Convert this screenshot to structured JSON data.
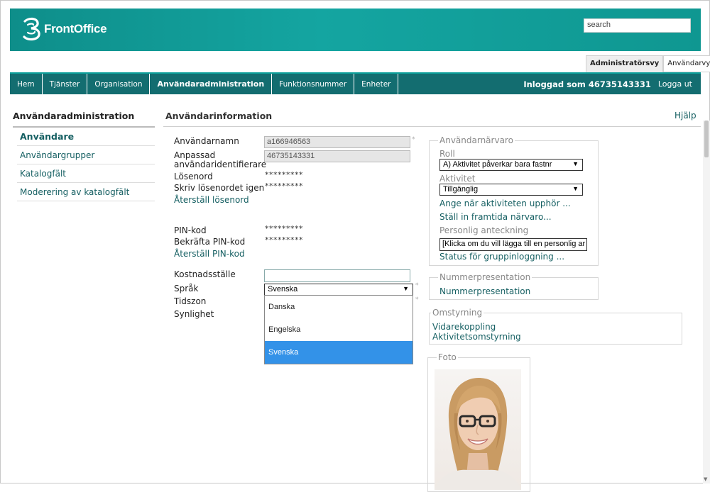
{
  "header": {
    "logo_text": "FrontOffice",
    "search_placeholder": "search"
  },
  "view_switch": {
    "admin_view": "Administratörsvy",
    "user_view": "Användarvy"
  },
  "nav": {
    "items": [
      "Hem",
      "Tjänster",
      "Organisation",
      "Användaradministration",
      "Funktionsnummer",
      "Enheter"
    ],
    "logged_in": "Inloggad som 46735143331",
    "logout": "Logga ut"
  },
  "sidebar": {
    "title": "Användaradministration",
    "items": [
      "Användare",
      "Användargrupper",
      "Katalogfält",
      "Moderering av katalogfält"
    ]
  },
  "main": {
    "title": "Användarinformation",
    "help": "Hjälp",
    "username_label": "Användarnamn",
    "username_value": "a166946563",
    "custom_id_label_1": "Anpassad",
    "custom_id_label_2": "användaridentifierare",
    "custom_id_value": "46735143331",
    "password_label": "Lösenord",
    "password_value": "*********",
    "password_confirm_label": "Skriv lösenordet igen",
    "password_confirm_value": "*********",
    "reset_password": "Återställ lösenord",
    "pin_label": "PIN-kod",
    "pin_value": "*********",
    "pin_confirm_label": "Bekräfta PIN-kod",
    "pin_confirm_value": "*********",
    "reset_pin": "Återställ PIN-kod",
    "cost_center_label": "Kostnadsställe",
    "cost_center_value": "",
    "language_label": "Språk",
    "language_value": "Svenska",
    "language_options": [
      "Danska",
      "Engelska",
      "Svenska"
    ],
    "timezone_label": "Tidszon",
    "visibility_label": "Synlighet",
    "required_mark": "*"
  },
  "presence": {
    "legend": "Användarnärvaro",
    "role_label": "Roll",
    "role_value": "A) Aktivitet påverkar bara fastnr",
    "activity_label": "Aktivitet",
    "activity_value": "Tillgänglig",
    "end_link": "Ange när aktiviteten upphör ...",
    "future_link": "Ställ in framtida närvaro...",
    "note_label": "Personlig anteckning",
    "note_value": "[Klicka om du vill lägga till en personlig ar",
    "group_login_link": "Status för gruppinloggning ..."
  },
  "number_presentation": {
    "legend": "Nummerpresentation",
    "link": "Nummerpresentation"
  },
  "redirect": {
    "legend": "Omstyrning",
    "forwarding": "Vidarekoppling",
    "activity_redirect": "Aktivitetsomstyrning"
  },
  "photo": {
    "legend": "Foto"
  },
  "colors": {
    "brand_teal": "#14a5a1",
    "nav_dark": "#136d70",
    "link": "#155f62",
    "selected_option": "#3392e8"
  }
}
